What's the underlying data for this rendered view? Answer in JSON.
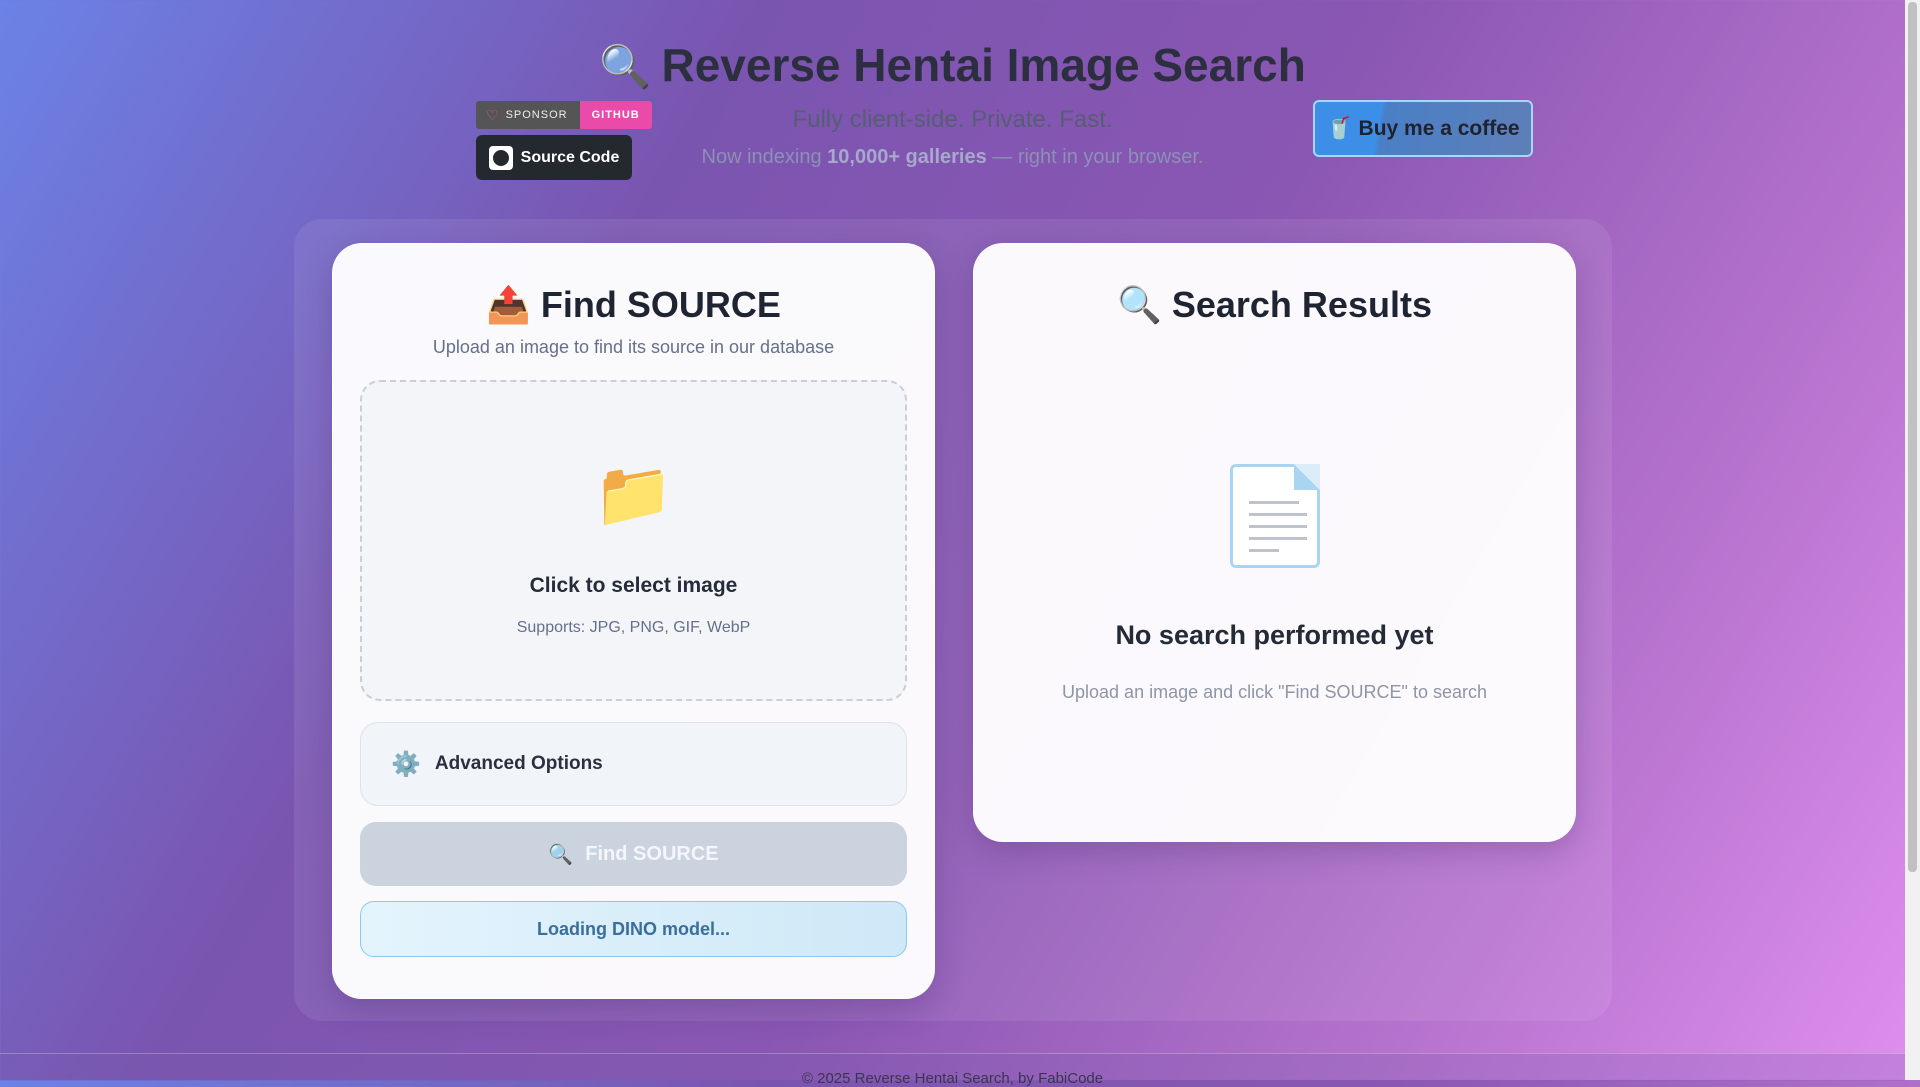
{
  "header": {
    "title_icon": "🔍",
    "title": "Reverse Hentai Image Search",
    "subtitle": "Fully client-side. Private. Fast.",
    "indexing_pre": "Now indexing ",
    "indexing_bold": "10,000+ galleries",
    "indexing_post": " — right in your browser.",
    "sponsor_label": "SPONSOR",
    "sponsor_github": "GITHUB",
    "source_code": "Source Code",
    "coffee_icon": "🥤",
    "coffee_label": "Buy me a coffee"
  },
  "left_card": {
    "icon": "📤",
    "title": "Find SOURCE",
    "description": "Upload an image to find its source in our database",
    "dropzone": {
      "icon": "📁",
      "label": "Click to select image",
      "supports": "Supports: JPG, PNG, GIF, WebP"
    },
    "advanced_icon": "⚙️",
    "advanced_label": "Advanced Options",
    "find_icon": "🔍",
    "find_label": "Find SOURCE",
    "status": "Loading DINO model..."
  },
  "right_card": {
    "icon": "🔍",
    "title": "Search Results",
    "empty_title": "No search performed yet",
    "empty_hint": "Upload an image and click \"Find SOURCE\" to search"
  },
  "footer": {
    "text": "© 2025 Reverse Hentai Search, by FabiCode"
  },
  "colors": {
    "accent_pink": "#ea4aaa",
    "coffee_blue": "#3d8ee6",
    "disabled_button": "#cbd3de"
  }
}
